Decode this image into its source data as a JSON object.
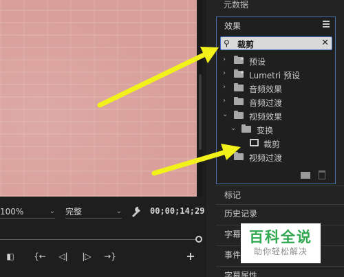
{
  "monitor": {
    "zoom": "100%",
    "quality": "完整",
    "timecode": "00;00;14;29",
    "transport": [
      "◧",
      "{←",
      "◁|",
      "|▷",
      "→}",
      "+"
    ]
  },
  "top_panel_label": "元数据",
  "effects": {
    "title": "效果",
    "search_value": "裁剪",
    "tree": {
      "presets": "预设",
      "lumetri": "Lumetri 预设",
      "audio_effects": "音频效果",
      "audio_transitions": "音频过渡",
      "video_effects": "视频效果",
      "transform": "变换",
      "crop": "裁剪",
      "video_transitions": "视频过渡"
    }
  },
  "sections": [
    "标记",
    "历史记录",
    "字幕",
    "事件",
    "字幕属性"
  ],
  "watermark": {
    "title": "百科全说",
    "subtitle": "助你轻松解决"
  },
  "colors": {
    "arrow": "#f2f21a",
    "accent": "#4b6fa8",
    "watermark_green": "#2fa84f"
  }
}
